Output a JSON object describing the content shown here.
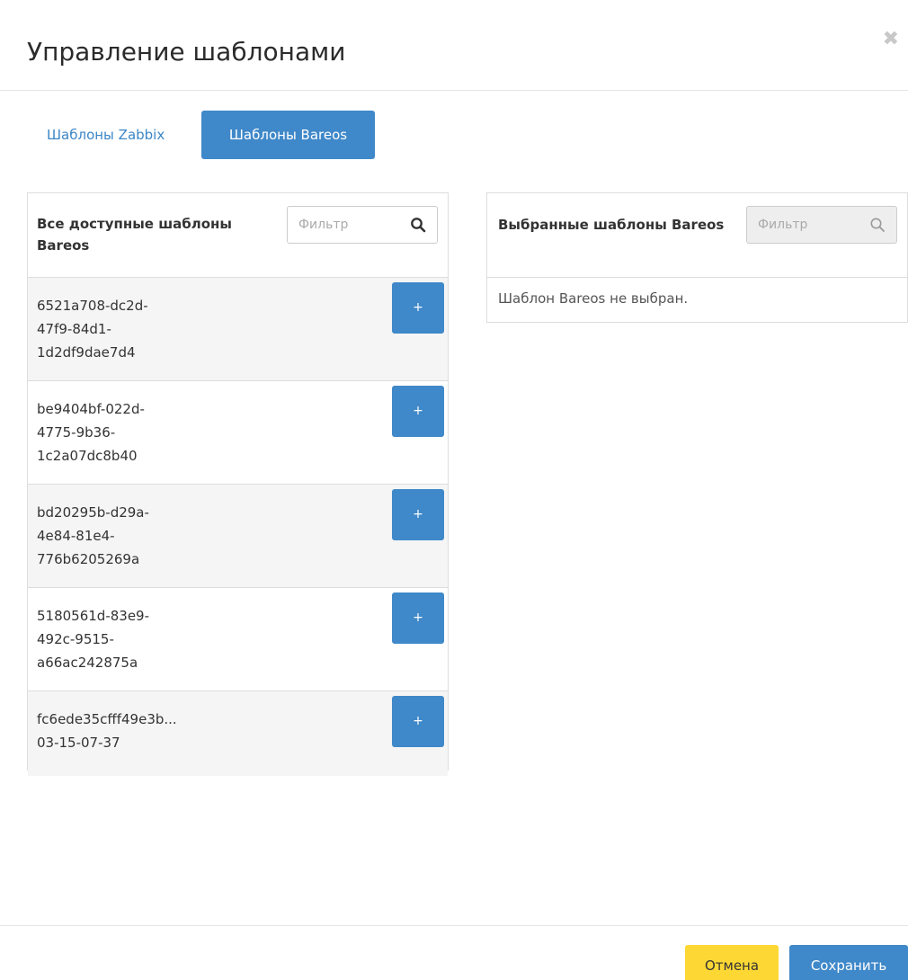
{
  "modal": {
    "title": "Управление шаблонами",
    "close_glyph": "✖"
  },
  "tabs": [
    {
      "label": "Шаблоны Zabbix",
      "active": false
    },
    {
      "label": "Шаблоны Bareos",
      "active": true
    }
  ],
  "available": {
    "title": "Все доступные шаблоны Bareos",
    "filter_placeholder": "Фильтр",
    "add_label": "+",
    "items": [
      {
        "id": "6521a708-dc2d-\n47f9-84d1-\n1d2df9dae7d4"
      },
      {
        "id": "be9404bf-022d-\n4775-9b36-\n1c2a07dc8b40"
      },
      {
        "id": "bd20295b-d29a-\n4e84-81e4-\n776b6205269a"
      },
      {
        "id": "5180561d-83e9-\n492c-9515-\na66ac242875a"
      },
      {
        "id": "fc6ede35cfff49e3b...\n03-15-07-37"
      }
    ]
  },
  "selected": {
    "title": "Выбранные шаблоны Bareos",
    "filter_placeholder": "Фильтр",
    "empty_message": "Шаблон Bareos не выбран."
  },
  "footer": {
    "cancel_label": "Отмена",
    "save_label": "Сохранить"
  },
  "colors": {
    "primary": "#3f88c9",
    "cancel": "#fdd835",
    "row_alt": "#f5f5f5"
  },
  "icons": {
    "close": "close-icon",
    "search": "search-icon"
  }
}
